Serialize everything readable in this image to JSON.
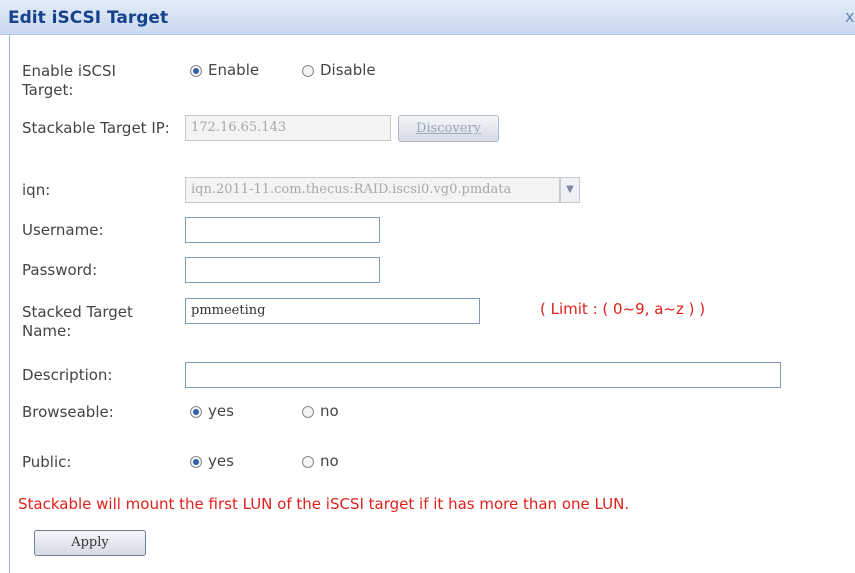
{
  "window": {
    "title": "Edit iSCSI Target",
    "close_glyph": "x"
  },
  "form": {
    "enable": {
      "label": "Enable iSCSI Target:",
      "options": [
        "Enable",
        "Disable"
      ],
      "selected": "Enable"
    },
    "stackable_ip": {
      "label": "Stackable Target IP:",
      "value": "172.16.65.143",
      "button": "Discovery"
    },
    "iqn": {
      "label": "iqn:",
      "value": "iqn.2011-11.com.thecus:RAID.iscsi0.vg0.pmdata"
    },
    "username": {
      "label": "Username:",
      "value": ""
    },
    "password": {
      "label": "Password:",
      "value": ""
    },
    "stacked_name": {
      "label": "Stacked Target Name:",
      "value": "pmmeeting",
      "hint": "( Limit : ( 0~9, a~z ) )"
    },
    "description": {
      "label": "Description:",
      "value": ""
    },
    "browseable": {
      "label": "Browseable:",
      "options": [
        "yes",
        "no"
      ],
      "selected": "yes"
    },
    "public": {
      "label": "Public:",
      "options": [
        "yes",
        "no"
      ],
      "selected": "yes"
    },
    "notice": "Stackable will mount the first LUN of the iSCSI target if it has more than one LUN.",
    "apply_label": "Apply"
  },
  "colors": {
    "accent": "#15428b",
    "warning": "#e0201b",
    "titlebar": "#c9d9ef"
  }
}
